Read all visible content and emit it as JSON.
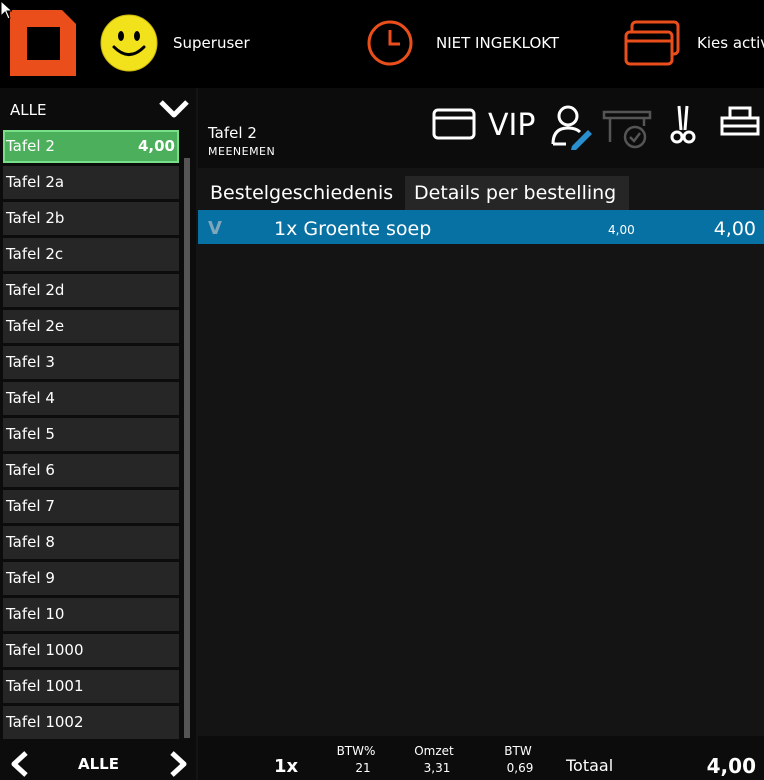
{
  "topbar": {
    "username": "Superuser",
    "clock_status": "NIET INGEKLOKT",
    "activity_label": "Kies activiteit",
    "colors": {
      "accent": "#e94e1b",
      "smiley": "#f2e21b"
    }
  },
  "sidebar": {
    "filter_label": "ALLE",
    "nav_label": "ALLE",
    "tables": [
      {
        "name": "Tafel 2",
        "amount": "4,00",
        "selected": true
      },
      {
        "name": "Tafel 2a",
        "amount": ""
      },
      {
        "name": "Tafel 2b",
        "amount": ""
      },
      {
        "name": "Tafel 2c",
        "amount": ""
      },
      {
        "name": "Tafel 2d",
        "amount": ""
      },
      {
        "name": "Tafel 2e",
        "amount": ""
      },
      {
        "name": "Tafel 3",
        "amount": ""
      },
      {
        "name": "Tafel 4",
        "amount": ""
      },
      {
        "name": "Tafel 5",
        "amount": ""
      },
      {
        "name": "Tafel 6",
        "amount": ""
      },
      {
        "name": "Tafel 7",
        "amount": ""
      },
      {
        "name": "Tafel 8",
        "amount": ""
      },
      {
        "name": "Tafel 9",
        "amount": ""
      },
      {
        "name": "Tafel 10",
        "amount": ""
      },
      {
        "name": "Tafel 1000",
        "amount": ""
      },
      {
        "name": "Tafel 1001",
        "amount": ""
      },
      {
        "name": "Tafel 1002",
        "amount": ""
      }
    ]
  },
  "order": {
    "table_title": "Tafel 2",
    "order_type": "MEENEMEN",
    "vip_label": "VIP",
    "tabs": {
      "history": "Bestelgeschiedenis",
      "details": "Details per bestelling"
    },
    "rows": [
      {
        "status": "V",
        "item": "1x Groente soep",
        "unit_price": "4,00",
        "total": "4,00"
      }
    ]
  },
  "footer": {
    "qty": "1x",
    "btw_pct_label": "BTW%",
    "btw_pct_value": "21",
    "omzet_label": "Omzet",
    "omzet_value": "3,31",
    "btw_label": "BTW",
    "btw_value": "0,69",
    "totaal_label": "Totaal",
    "totaal_value": "4,00"
  }
}
